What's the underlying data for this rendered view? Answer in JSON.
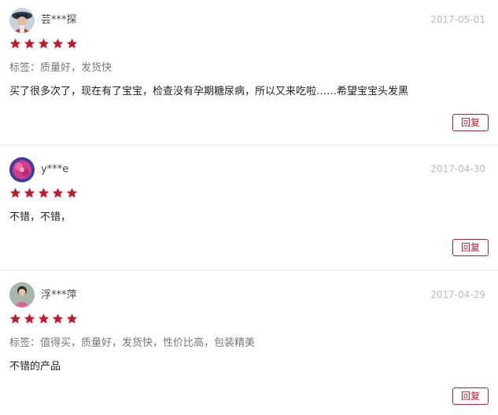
{
  "theme": {
    "star_color": "#c4192b",
    "reply_color": "#c4192b"
  },
  "reviews": [
    {
      "username": "芸***探",
      "date": "2017-05-01",
      "rating": 5,
      "tags": "标签：质量好，发货快",
      "content": "买了很多次了，现在有了宝宝，检查没有孕期糖尿病，所以又来吃啦……希望宝宝头发黑",
      "reply_label": "回复",
      "avatar": "avatar-photo-person-with-hat"
    },
    {
      "username": "y***e",
      "date": "2017-04-30",
      "rating": 5,
      "tags": "",
      "content": "不错，不错，",
      "reply_label": "回复",
      "avatar": "avatar-photo-pink-flower"
    },
    {
      "username": "浮***萍",
      "date": "2017-04-29",
      "rating": 5,
      "tags": "标签：值得买，质量好，发货快，性价比高，包装精美",
      "content": "不错的产品",
      "reply_label": "回复",
      "avatar": "avatar-photo-person-pink"
    }
  ]
}
